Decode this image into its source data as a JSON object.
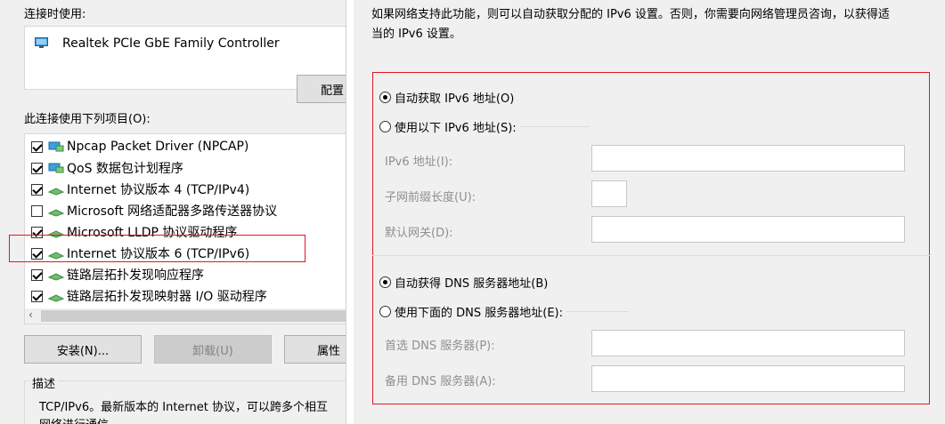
{
  "left": {
    "connect_using_label": "连接时使用:",
    "adapter_name": "Realtek PCIe GbE Family Controller",
    "configure_button": "配置",
    "items_label": "此连接使用下列项目(O):",
    "items": [
      {
        "label": "Npcap Packet Driver (NPCAP)",
        "checked": true
      },
      {
        "label": "QoS 数据包计划程序",
        "checked": true
      },
      {
        "label": "Internet 协议版本 4 (TCP/IPv4)",
        "checked": true
      },
      {
        "label": "Microsoft 网络适配器多路传送器协议",
        "checked": false
      },
      {
        "label": "Microsoft LLDP 协议驱动程序",
        "checked": true
      },
      {
        "label": "Internet 协议版本 6 (TCP/IPv6)",
        "checked": true
      },
      {
        "label": "链路层拓扑发现响应程序",
        "checked": true
      },
      {
        "label": "链路层拓扑发现映射器 I/O 驱动程序",
        "checked": true
      }
    ],
    "install_button": "安装(N)...",
    "uninstall_button": "卸载(U)",
    "properties_button": "属性",
    "description_title": "描述",
    "description_line1": "TCP/IPv6。最新版本的 Internet 协议，可以跨多个相互",
    "description_line2": "网络进行通信"
  },
  "right": {
    "intro_line1": "如果网络支持此功能，则可以自动获取分配的 IPv6 设置。否则，你需要向网络管理员咨询，以获得适",
    "intro_line2": "当的 IPv6 设置。",
    "auto_ip": "自动获取 IPv6 地址(O)",
    "manual_ip": "使用以下 IPv6 地址(S):",
    "ipv6_address_label": "IPv6 地址(I):",
    "prefix_label": "子网前缀长度(U):",
    "gateway_label": "默认网关(D):",
    "auto_dns": "自动获得 DNS 服务器地址(B)",
    "manual_dns": "使用下面的 DNS 服务器地址(E):",
    "preferred_dns_label": "首选 DNS 服务器(P):",
    "alternate_dns_label": "备用 DNS 服务器(A):"
  }
}
